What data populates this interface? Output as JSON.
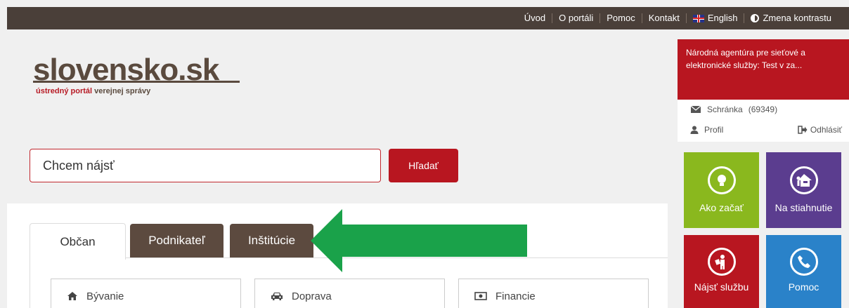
{
  "topnav": {
    "items": [
      {
        "label": "Úvod"
      },
      {
        "label": "O portáli"
      },
      {
        "label": "Pomoc"
      },
      {
        "label": "Kontakt"
      },
      {
        "label": "English",
        "icon": "uk-flag-icon"
      },
      {
        "label": "Zmena kontrastu",
        "icon": "contrast-icon"
      }
    ]
  },
  "logo": {
    "title": "slovensko.sk",
    "subtitle_red": "ústredný portál",
    "subtitle_brown": "verejnej správy"
  },
  "search": {
    "placeholder": "Chcem nájsť",
    "button_label": "Hľadať"
  },
  "tabs": [
    {
      "label": "Občan",
      "active": true
    },
    {
      "label": "Podnikateľ",
      "active": false
    },
    {
      "label": "Inštitúcie",
      "active": false
    }
  ],
  "categories": [
    {
      "label": "Bývanie",
      "icon": "home-icon"
    },
    {
      "label": "Doprava",
      "icon": "car-icon"
    },
    {
      "label": "Financie",
      "icon": "money-icon"
    }
  ],
  "sidebar": {
    "notification": "Národná agentúra pre sieťové a elektronické služby: Test v za...",
    "mailbox_label": "Schránka",
    "mailbox_count": "(69349)",
    "profile_label": "Profil",
    "logout_label": "Odhlásiť",
    "tiles": [
      {
        "label": "Ako začať",
        "color": "#8ab81e",
        "icon": "lightbulb-icon"
      },
      {
        "label": "Na stiahnutie",
        "color": "#5b3d8f",
        "icon": "download-person-icon"
      },
      {
        "label": "Nájsť službu",
        "color": "#b81620",
        "icon": "service-person-icon"
      },
      {
        "label": "Pomoc",
        "color": "#2a82c9",
        "icon": "phone-icon"
      }
    ]
  },
  "colors": {
    "brand_red": "#b81620",
    "brand_brown": "#5c4a3f",
    "arrow_green": "#1aa24a"
  }
}
